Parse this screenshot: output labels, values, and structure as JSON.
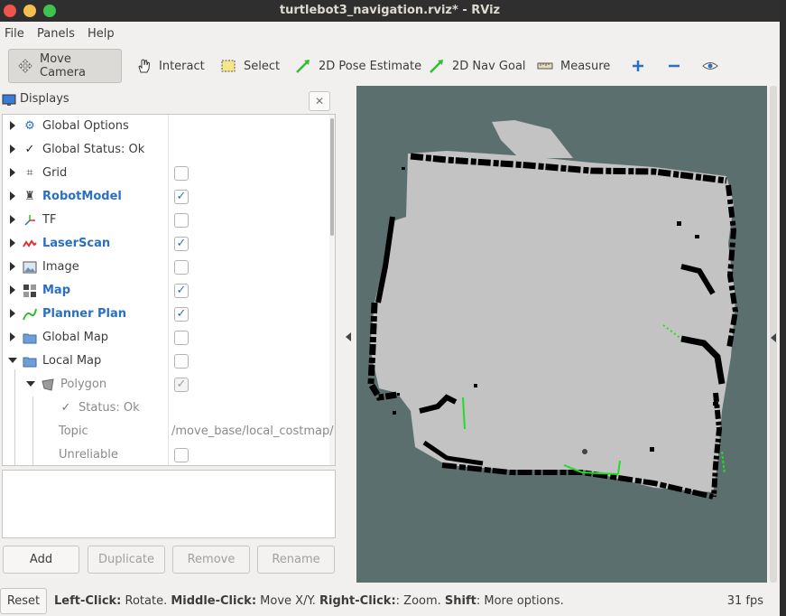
{
  "window": {
    "title": "turtlebot3_navigation.rviz* - RViz"
  },
  "menubar": {
    "items": [
      "File",
      "Panels",
      "Help"
    ]
  },
  "toolbar": {
    "tools": [
      {
        "label": "Move Camera",
        "icon": "move-camera-icon",
        "active": true
      },
      {
        "label": "Interact",
        "icon": "hand-icon"
      },
      {
        "label": "Select",
        "icon": "select-icon"
      },
      {
        "label": "2D Pose Estimate",
        "icon": "green-arrow-icon"
      },
      {
        "label": "2D Nav Goal",
        "icon": "green-arrow-icon"
      },
      {
        "label": "Measure",
        "icon": "ruler-icon"
      }
    ],
    "extra_icons": [
      "plus-icon",
      "minus-icon",
      "eye-icon"
    ],
    "accent": "#2a6fc6",
    "tool_green": "#2fbf2f"
  },
  "displays": {
    "title": "Displays",
    "rows": [
      {
        "label": "Global Options",
        "icon": "gear-icon"
      },
      {
        "label": "Global Status: Ok",
        "icon": "check-icon"
      },
      {
        "label": "Grid",
        "icon": "grid-icon",
        "checked": false
      },
      {
        "label": "RobotModel",
        "icon": "robot-icon",
        "checked": true,
        "bold": true
      },
      {
        "label": "TF",
        "icon": "tf-icon",
        "checked": false
      },
      {
        "label": "LaserScan",
        "icon": "laserscan-icon",
        "checked": true,
        "bold": true
      },
      {
        "label": "Image",
        "icon": "image-icon",
        "checked": false
      },
      {
        "label": "Map",
        "icon": "map-icon",
        "checked": true,
        "bold": true
      },
      {
        "label": "Planner Plan",
        "icon": "path-icon",
        "checked": true,
        "bold": true
      },
      {
        "label": "Global Map",
        "icon": "folder-icon",
        "checked": false
      },
      {
        "label": "Local Map",
        "icon": "folder-icon",
        "checked": false,
        "expanded": true
      },
      {
        "label": "Polygon",
        "icon": "polygon-icon",
        "checked": true,
        "dim": true,
        "expanded": true
      },
      {
        "label": "Status: Ok",
        "icon": "check-icon",
        "dim": true
      },
      {
        "label": "Topic",
        "value": "/move_base/local_costmap/",
        "dim": true
      },
      {
        "label": "Unreliable",
        "checked": false,
        "dim": true
      }
    ],
    "buttons": [
      "Add",
      "Duplicate",
      "Remove",
      "Rename"
    ]
  },
  "map": {
    "background": "#5c6f6f",
    "free": "#c3c3c3",
    "occupied": "#000000",
    "scan": "#22dd22"
  },
  "status": {
    "reset": "Reset",
    "hint_parts": [
      {
        "b": "Left-Click:",
        "t": " Rotate. "
      },
      {
        "b": "Middle-Click:",
        "t": " Move X/Y. "
      },
      {
        "b": "Right-Click:",
        "t": ": Zoom. "
      },
      {
        "b": "Shift",
        "t": ": More options."
      }
    ],
    "fps": "31 fps"
  }
}
